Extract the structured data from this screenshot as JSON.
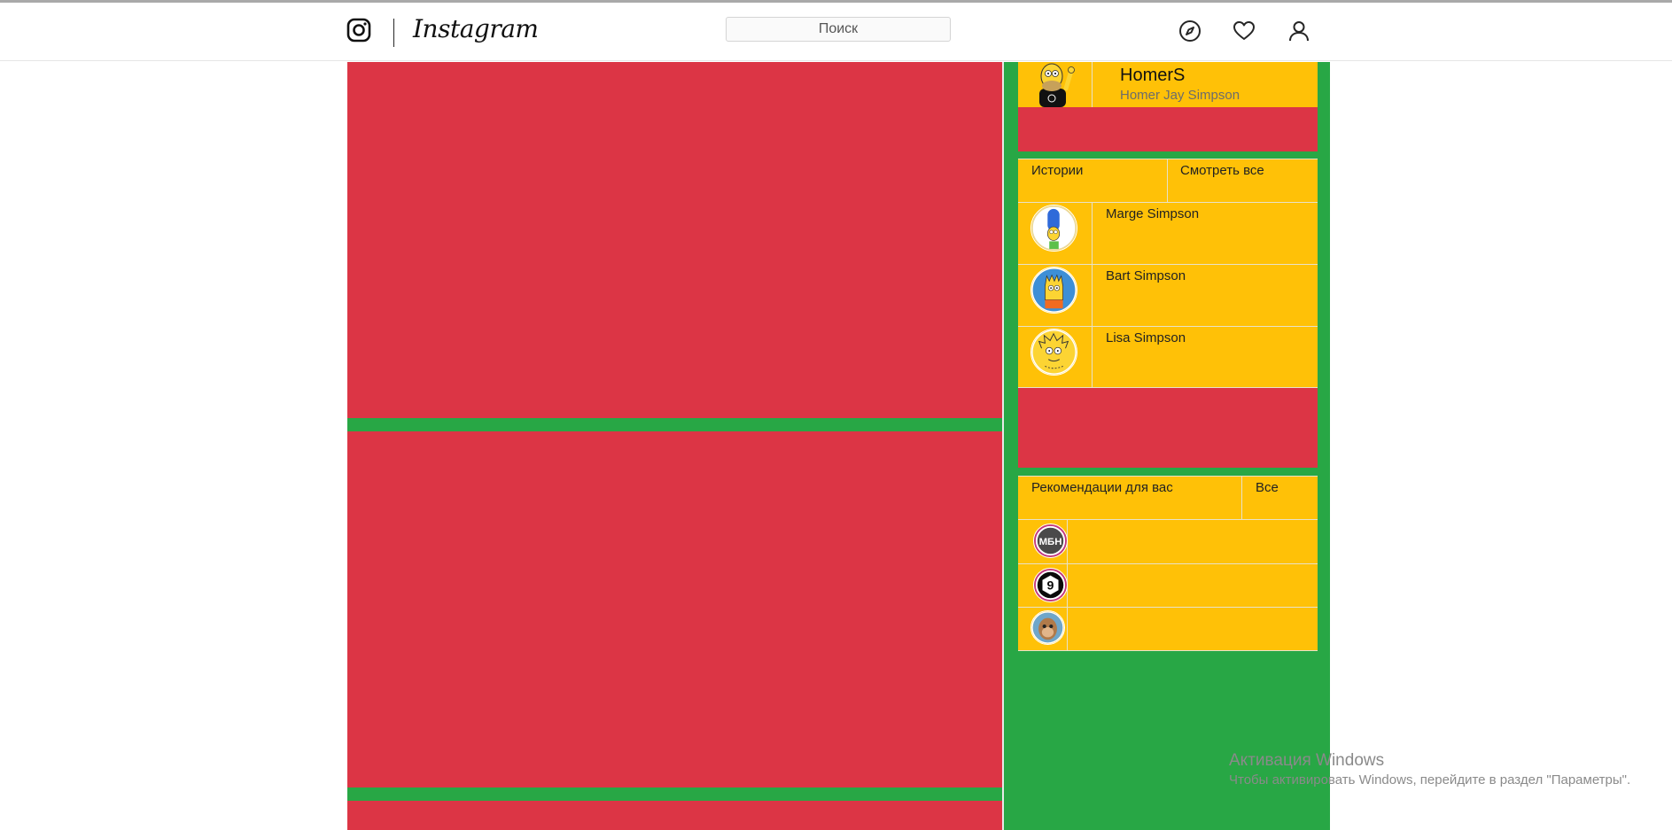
{
  "header": {
    "logo_text": "Instagram",
    "search_placeholder": "Поиск",
    "icons": [
      "instagram-camera-icon",
      "compass-icon",
      "heart-icon",
      "user-icon"
    ]
  },
  "profile": {
    "username": "HomerS",
    "full_name": "Homer Jay Simpson"
  },
  "stories": {
    "title": "Истории",
    "see_all": "Смотреть все",
    "items": [
      {
        "name": "Marge Simpson"
      },
      {
        "name": "Bart Simpson"
      },
      {
        "name": "Lisa Simpson"
      }
    ]
  },
  "recommendations": {
    "title": "Рекомендации для вас",
    "all": "Все",
    "items": [
      {
        "avatar_label": "МБН"
      },
      {
        "avatar_label": "9"
      },
      {
        "avatar_label": ""
      }
    ]
  },
  "watermark": {
    "title": "Активация Windows",
    "subtitle": "Чтобы активировать Windows, перейдите в раздел \"Параметры\"."
  },
  "colors": {
    "post": "#dc3545",
    "background": "#28a745",
    "card": "#ffc107"
  }
}
